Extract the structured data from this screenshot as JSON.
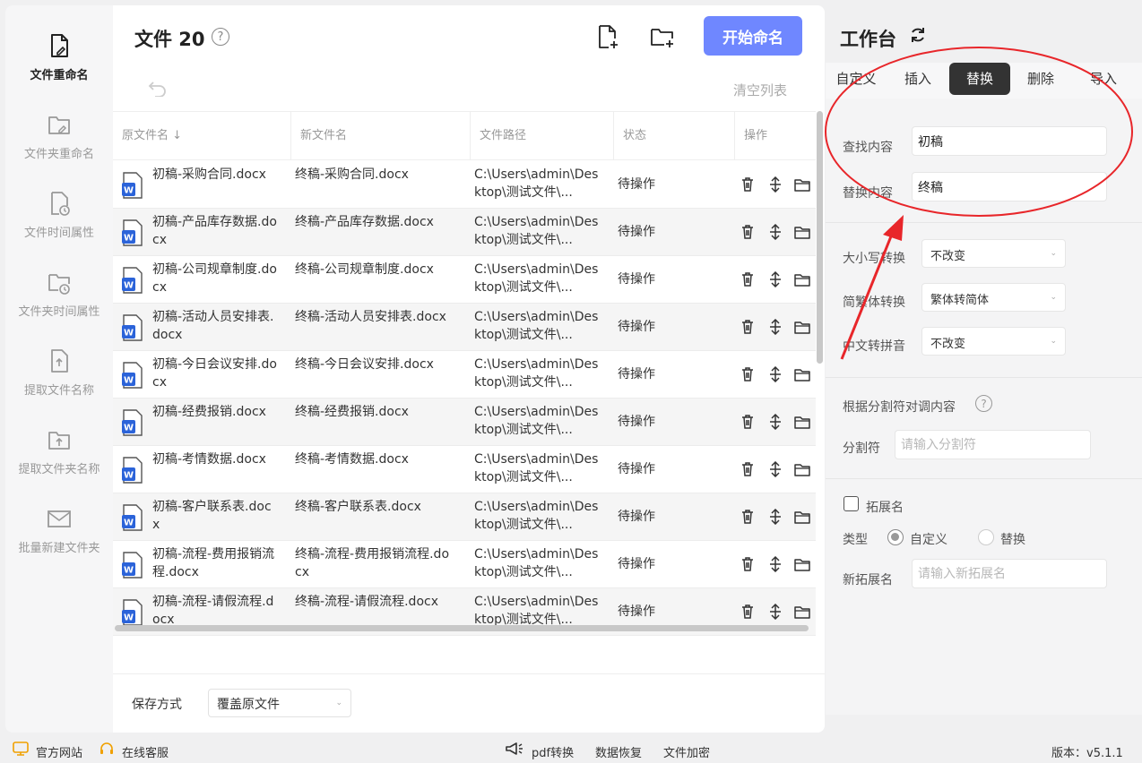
{
  "sidebar": {
    "items": [
      {
        "label": "文件重命名",
        "icon": "file-edit-icon",
        "active": true
      },
      {
        "label": "文件夹重命名",
        "icon": "folder-edit-icon"
      },
      {
        "label": "文件时间属性",
        "icon": "file-clock-icon"
      },
      {
        "label": "文件夹时间属性",
        "icon": "folder-clock-icon"
      },
      {
        "label": "提取文件名称",
        "icon": "file-extract-icon"
      },
      {
        "label": "提取文件夹名称",
        "icon": "folder-extract-icon"
      },
      {
        "label": "批量新建文件夹",
        "icon": "new-folder-batch-icon"
      }
    ]
  },
  "main": {
    "title": "文件 20",
    "help_icon": "?",
    "start_button": "开始命名",
    "clear_list": "清空列表",
    "columns": [
      "原文件名 ↓",
      "新文件名",
      "文件路径",
      "状态",
      "操作"
    ],
    "rows": [
      {
        "original": "初稿-采购合同.docx",
        "new": "终稿-采购合同.docx",
        "path": "C:\\Users\\admin\\Desktop\\测试文件\\...",
        "status": "待操作"
      },
      {
        "original": "初稿-产品库存数据.docx",
        "new": "终稿-产品库存数据.docx",
        "path": "C:\\Users\\admin\\Desktop\\测试文件\\...",
        "status": "待操作"
      },
      {
        "original": "初稿-公司规章制度.docx",
        "new": "终稿-公司规章制度.docx",
        "path": "C:\\Users\\admin\\Desktop\\测试文件\\...",
        "status": "待操作"
      },
      {
        "original": "初稿-活动人员安排表.docx",
        "new": "终稿-活动人员安排表.docx",
        "path": "C:\\Users\\admin\\Desktop\\测试文件\\...",
        "status": "待操作"
      },
      {
        "original": "初稿-今日会议安排.docx",
        "new": "终稿-今日会议安排.docx",
        "path": "C:\\Users\\admin\\Desktop\\测试文件\\...",
        "status": "待操作"
      },
      {
        "original": "初稿-经费报销.docx",
        "new": "终稿-经费报销.docx",
        "path": "C:\\Users\\admin\\Desktop\\测试文件\\...",
        "status": "待操作"
      },
      {
        "original": "初稿-考情数据.docx",
        "new": "终稿-考情数据.docx",
        "path": "C:\\Users\\admin\\Desktop\\测试文件\\...",
        "status": "待操作"
      },
      {
        "original": "初稿-客户联系表.docx",
        "new": "终稿-客户联系表.docx",
        "path": "C:\\Users\\admin\\Desktop\\测试文件\\...",
        "status": "待操作"
      },
      {
        "original": "初稿-流程-费用报销流程.docx",
        "new": "终稿-流程-费用报销流程.docx",
        "path": "C:\\Users\\admin\\Desktop\\测试文件\\...",
        "status": "待操作"
      },
      {
        "original": "初稿-流程-请假流程.docx",
        "new": "终稿-流程-请假流程.docx",
        "path": "C:\\Users\\admin\\Desktop\\测试文件\\...",
        "status": "待操作"
      }
    ],
    "save_mode_label": "保存方式",
    "save_mode_value": "覆盖原文件"
  },
  "workbench": {
    "title": "工作台",
    "tabs": [
      {
        "label": "自定义"
      },
      {
        "label": "插入"
      },
      {
        "label": "替换",
        "active": true
      },
      {
        "label": "删除"
      },
      {
        "label": "导入"
      }
    ],
    "find_label": "查找内容",
    "find_value": "初稿",
    "replace_label": "替换内容",
    "replace_value": "终稿",
    "case_label": "大小写转换",
    "case_value": "不改变",
    "trad_label": "简繁体转换",
    "trad_value": "繁体转简体",
    "pinyin_label": "中文转拼音",
    "pinyin_value": "不改变",
    "split_title": "根据分割符对调内容",
    "split_label": "分割符",
    "split_placeholder": "请输入分割符",
    "ext_label": "拓展名",
    "type_label": "类型",
    "type_option_custom": "自定义",
    "type_option_replace": "替换",
    "new_ext_label": "新拓展名",
    "new_ext_placeholder": "请输入新拓展名"
  },
  "statusbar": {
    "website": "官方网站",
    "support": "在线客服",
    "pdf": "pdf转换",
    "recovery": "数据恢复",
    "encrypt": "文件加密",
    "version": "版本：v5.1.1"
  },
  "colors": {
    "accent": "#6f87ff",
    "annotation": "#e8262a",
    "word_blue": "#2b63d9"
  }
}
